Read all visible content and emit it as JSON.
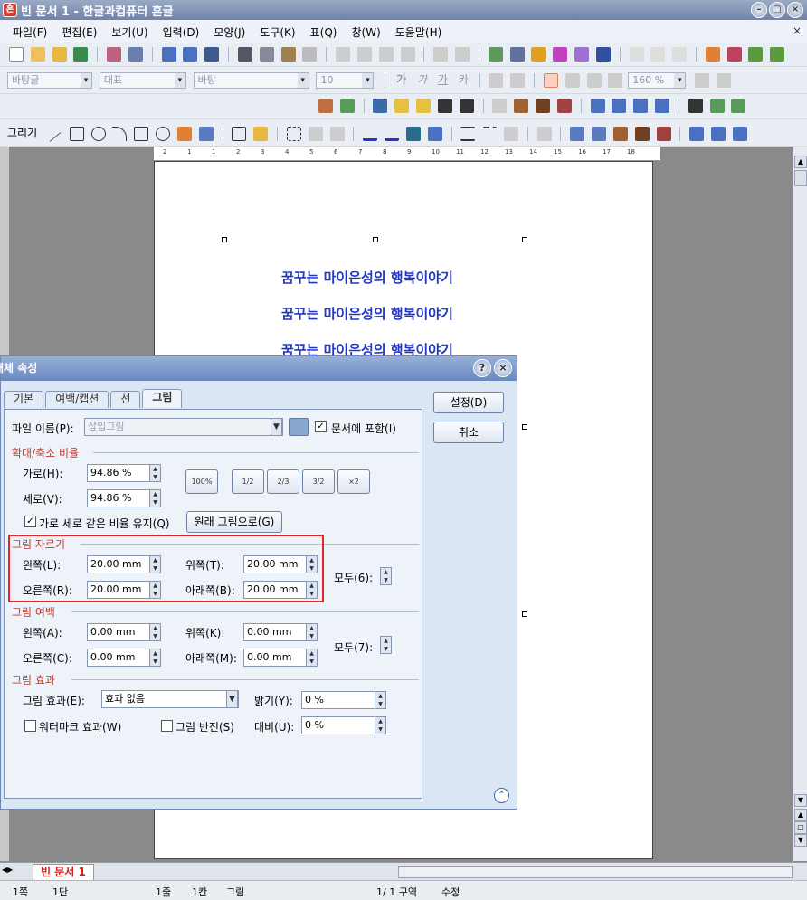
{
  "window": {
    "title": "빈 문서 1 - 한글과컴퓨터 흔글",
    "app_icon_glyph": "흔",
    "buttons": [
      "–",
      "□",
      "×"
    ]
  },
  "menu": {
    "items": [
      "파일(F)",
      "편집(E)",
      "보기(U)",
      "입력(D)",
      "모양(J)",
      "도구(K)",
      "표(Q)",
      "창(W)",
      "도움말(H)"
    ],
    "close": "×"
  },
  "format_toolbar": {
    "style": "바탕글",
    "font_lang": "대표",
    "font": "바탕",
    "size": "10",
    "zoom": "160 %",
    "bold": "가",
    "italic": "가",
    "underline": "가",
    "outline": "카"
  },
  "draw_toolbar": {
    "label": "그리기"
  },
  "ruler": {
    "ticks": [
      "2",
      "1",
      "1",
      "2",
      "3",
      "4",
      "5",
      "6",
      "7",
      "8",
      "9",
      "10",
      "11",
      "12",
      "13",
      "14",
      "15",
      "16",
      "17",
      "18"
    ]
  },
  "document": {
    "lines": [
      "꿈꾸는 마이은성의 행복이야기",
      "꿈꾸는 마이은성의 행복이야기",
      "꿈꾸는 마이은성의 행복이야기"
    ]
  },
  "dialog": {
    "title": "개체 속성",
    "help": "?",
    "close": "×",
    "tabs": [
      "기본",
      "여백/캡션",
      "선",
      "그림"
    ],
    "file_label": "파일 이름(P):",
    "file_value": "삽입그림",
    "include_label": "문서에 포함(I)",
    "include_checked": "✓",
    "ok": "설정(D)",
    "cancel": "취소",
    "scale": {
      "title": "확대/축소 비율",
      "width_label": "가로(H):",
      "width_value": "94.86 %",
      "height_label": "세로(V):",
      "height_value": "94.86 %",
      "keep_label": "가로 세로 같은 비율 유지(Q)",
      "keep_checked": "✓",
      "original_button": "원래 그림으로(G)",
      "zoom_buttons": [
        "100%",
        "1/2",
        "2/3",
        "3/2",
        "×2"
      ]
    },
    "crop": {
      "title": "그림 자르기",
      "left_label": "왼쪽(L):",
      "left_value": "20.00 mm",
      "top_label": "위쪽(T):",
      "top_value": "20.00 mm",
      "right_label": "오른쪽(R):",
      "right_value": "20.00 mm",
      "bottom_label": "아래쪽(B):",
      "bottom_value": "20.00 mm",
      "all_label": "모두(6):"
    },
    "margin": {
      "title": "그림 여백",
      "left_label": "왼쪽(A):",
      "left_value": "0.00 mm",
      "top_label": "위쪽(K):",
      "top_value": "0.00 mm",
      "right_label": "오른쪽(C):",
      "right_value": "0.00 mm",
      "bottom_label": "아래쪽(M):",
      "bottom_value": "0.00 mm",
      "all_label": "모두(7):"
    },
    "effect": {
      "title": "그림 효과",
      "effect_label": "그림 효과(E):",
      "effect_value": "효과 없음",
      "brightness_label": "밝기(Y):",
      "brightness_value": "0 %",
      "watermark_label": "워터마크 효과(W)",
      "invert_label": "그림 반전(S)",
      "contrast_label": "대비(U):",
      "contrast_value": "0 %"
    }
  },
  "tabs_bar": {
    "doc_tab": "빈 문서 1"
  },
  "status": {
    "page": "1쪽",
    "column": "1단",
    "line": "1줄",
    "col": "1칸",
    "object": "그림",
    "page_count": "1/ 1 구역",
    "mode": "수정"
  },
  "colors": {
    "accent": "#2137c4",
    "highlight_box": "#e1262c",
    "group_title": "#c0392b"
  }
}
